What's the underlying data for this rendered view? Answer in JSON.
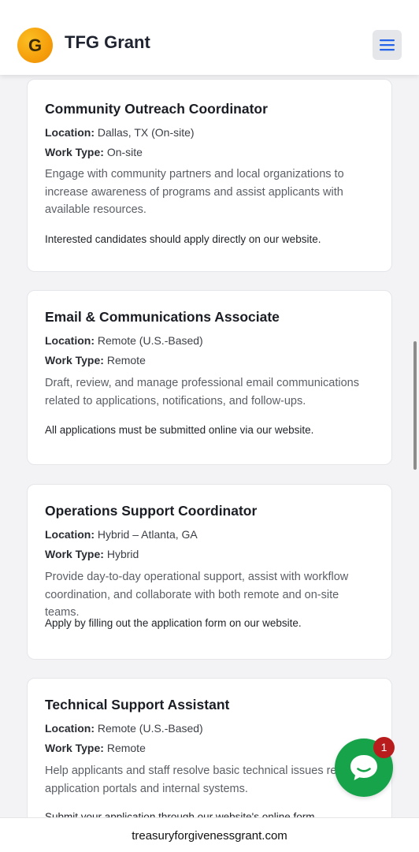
{
  "header": {
    "logo_letter": "G",
    "brand": "TFG Grant",
    "menu_icon": "hamburger-menu-icon"
  },
  "jobs": [
    {
      "title": "Community Outreach Coordinator",
      "location_label": "Location:",
      "location": "Dallas, TX (On-site)",
      "work_type_label": "Work Type:",
      "work_type": "On-site",
      "description": "Engage with community partners and local organizations to increase awareness of programs and assist applicants with available resources.",
      "apply_note": "Interested candidates should apply directly on our website."
    },
    {
      "title": "Email & Communications Associate",
      "location_label": "Location:",
      "location": "Remote (U.S.-Based)",
      "work_type_label": "Work Type:",
      "work_type": "Remote",
      "description": "Draft, review, and manage professional email communications related to applications, notifications, and follow-ups.",
      "apply_note": "All applications must be submitted online via our website."
    },
    {
      "title": "Operations Support Coordinator",
      "location_label": "Location:",
      "location": "Hybrid – Atlanta, GA",
      "work_type_label": "Work Type:",
      "work_type": "Hybrid",
      "description": "Provide day-to-day operational support, assist with workflow coordination, and collaborate with both remote and on-site teams.",
      "apply_note": "Apply by filling out the application form on our website."
    },
    {
      "title": "Technical Support Assistant",
      "location_label": "Location:",
      "location": "Remote (U.S.-Based)",
      "work_type_label": "Work Type:",
      "work_type": "Remote",
      "description": "Help applicants and staff resolve basic technical issues related to application portals and internal systems.",
      "apply_note": "Submit your application through our website's online form."
    }
  ],
  "chat": {
    "icon": "chat-bubble-icon",
    "badge_count": "1",
    "color": "#16a34a",
    "badge_color": "#b91c1c"
  },
  "browser": {
    "url": "treasuryforgivenessgrant.com"
  }
}
